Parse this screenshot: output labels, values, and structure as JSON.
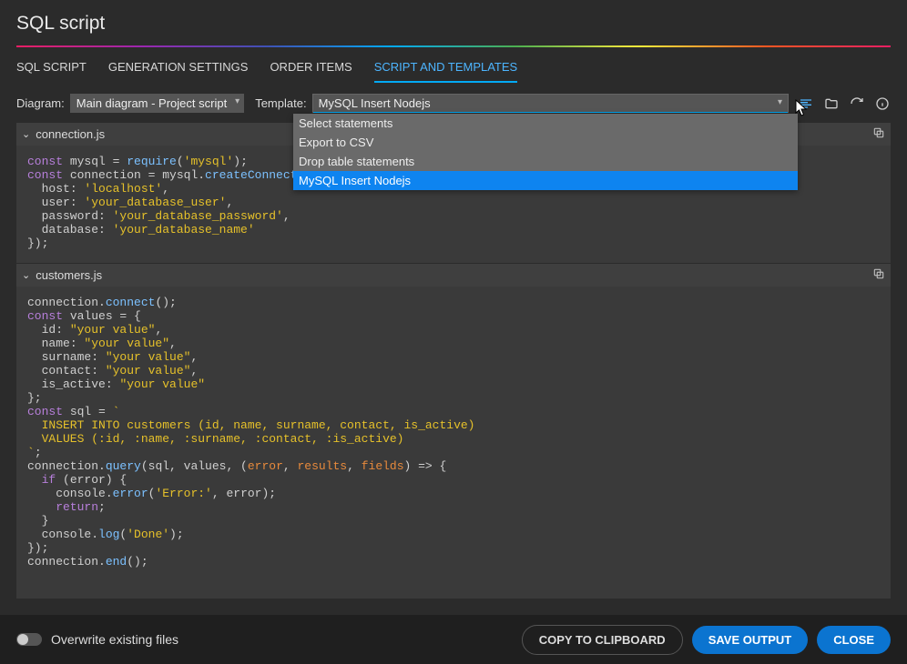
{
  "header": {
    "title": "SQL script"
  },
  "tabs": [
    {
      "label": "SQL SCRIPT"
    },
    {
      "label": "GENERATION SETTINGS"
    },
    {
      "label": "ORDER ITEMS"
    },
    {
      "label": "SCRIPT AND TEMPLATES"
    }
  ],
  "activeTabIndex": 3,
  "toolbar": {
    "diagramLabel": "Diagram:",
    "diagramValue": "Main diagram - Project script",
    "templateLabel": "Template:",
    "templateValue": "MySQL Insert Nodejs",
    "dropdownOptions": [
      "Select statements",
      "Export to CSV",
      "Drop table statements",
      "MySQL Insert Nodejs"
    ]
  },
  "files": [
    {
      "name": "connection.js"
    },
    {
      "name": "customers.js"
    }
  ],
  "code1": {
    "l1a": "const",
    "l1b": " mysql = ",
    "l1c": "require",
    "l1d": "(",
    "l1e": "'mysql'",
    "l1f": ");",
    "l2a": "const",
    "l2b": " connection = mysql.",
    "l2c": "createConnection",
    "l2d": "({",
    "l3a": "  host",
    "l3b": ": ",
    "l3c": "'localhost'",
    "l3d": ",",
    "l4a": "  user",
    "l4b": ": ",
    "l4c": "'your_database_user'",
    "l4d": ",",
    "l5a": "  password",
    "l5b": ": ",
    "l5c": "'your_database_password'",
    "l5d": ",",
    "l6a": "  database",
    "l6b": ": ",
    "l6c": "'your_database_name'",
    "l7": "});"
  },
  "code2": {
    "l1a": "connection.",
    "l1b": "connect",
    "l1c": "();",
    "l2a": "const",
    "l2b": " values = {",
    "l3a": "  id",
    "l3b": ": ",
    "l3c": "\"your value\"",
    "l3d": ",",
    "l4a": "  name",
    "l4b": ": ",
    "l4c": "\"your value\"",
    "l4d": ",",
    "l5a": "  surname",
    "l5b": ": ",
    "l5c": "\"your value\"",
    "l5d": ",",
    "l6a": "  contact",
    "l6b": ": ",
    "l6c": "\"your value\"",
    "l6d": ",",
    "l7a": "  is_active",
    "l7b": ": ",
    "l7c": "\"your value\"",
    "l8": "};",
    "l9a": "const",
    "l9b": " sql = ",
    "l9c": "`",
    "l10": "  INSERT INTO customers (id, name, surname, contact, is_active)",
    "l11": "  VALUES (:id, :name, :surname, :contact, :is_active)",
    "l12": "`",
    "l12b": ";",
    "l13a": "connection.",
    "l13b": "query",
    "l13c": "(sql, values, (",
    "l13d": "error",
    "l13e": ", ",
    "l13f": "results",
    "l13g": ", ",
    "l13h": "fields",
    "l13i": ") => {",
    "l14a": "  if",
    "l14b": " (error) {",
    "l15a": "    console.",
    "l15b": "error",
    "l15c": "(",
    "l15d": "'Error:'",
    "l15e": ", error);",
    "l16a": "    return",
    "l16b": ";",
    "l17": "  }",
    "l18a": "  console.",
    "l18b": "log",
    "l18c": "(",
    "l18d": "'Done'",
    "l18e": ");",
    "l19": "});",
    "l20a": "connection.",
    "l20b": "end",
    "l20c": "();"
  },
  "footer": {
    "toggleLabel": "Overwrite existing files",
    "copyBtn": "COPY TO CLIPBOARD",
    "saveBtn": "SAVE OUTPUT",
    "closeBtn": "CLOSE"
  }
}
